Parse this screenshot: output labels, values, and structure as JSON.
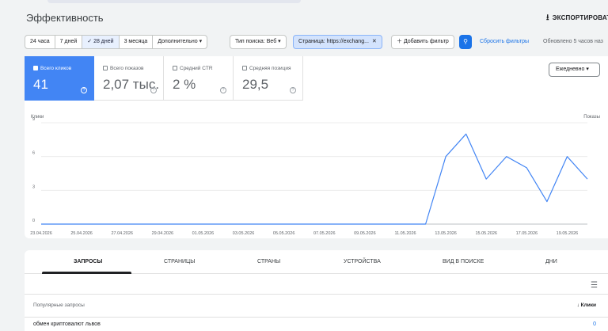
{
  "header": {
    "title": "Эффективность",
    "export_label": "ЭКСПОРТИРОВАТЬ"
  },
  "filters": {
    "date_ranges": [
      "24 часа",
      "7 дней",
      "28 дней",
      "3 месяца",
      "Дополнительно"
    ],
    "selected_range": "28 дней",
    "search_type": "Тип поиска: Веб",
    "page_filter": "Страница: https://exchang...",
    "add_filter": "Добавить фильтр",
    "reset": "Сбросить фильтры",
    "updated": "Обновлено 5 часов наз"
  },
  "metrics": [
    {
      "label": "Всего кликов",
      "value": "41",
      "active": true
    },
    {
      "label": "Всего показов",
      "value": "2,07 тыс.",
      "active": false
    },
    {
      "label": "Средний CTR",
      "value": "2 %",
      "active": false
    },
    {
      "label": "Средняя позиция",
      "value": "29,5",
      "active": false
    }
  ],
  "granularity": "Ежедневно",
  "chart_data": {
    "type": "line",
    "y_left_label": "Клики",
    "y_right_label": "Показы",
    "y_ticks": [
      "9",
      "6",
      "3",
      "0"
    ],
    "ylim": [
      0,
      9
    ],
    "x_tick_labels": [
      "23.04.2026",
      "25.04.2026",
      "27.04.2026",
      "29.04.2026",
      "01.05.2026",
      "03.05.2026",
      "05.05.2026",
      "07.05.2026",
      "09.05.2026",
      "11.05.2026",
      "13.05.2026",
      "15.05.2026",
      "17.05.2026",
      "19.05.2026"
    ],
    "x": [
      "23.04.2026",
      "24.04.2026",
      "25.04.2026",
      "26.04.2026",
      "27.04.2026",
      "28.04.2026",
      "29.04.2026",
      "30.04.2026",
      "01.05.2026",
      "02.05.2026",
      "03.05.2026",
      "04.05.2026",
      "05.05.2026",
      "06.05.2026",
      "07.05.2026",
      "08.05.2026",
      "09.05.2026",
      "10.05.2026",
      "11.05.2026",
      "12.05.2026",
      "13.05.2026",
      "14.05.2026",
      "15.05.2026",
      "16.05.2026",
      "17.05.2026",
      "18.05.2026",
      "19.05.2026",
      "20.05.2026"
    ],
    "series": [
      {
        "values": [
          0,
          0,
          0,
          0,
          0,
          0,
          0,
          0,
          0,
          0,
          0,
          0,
          0,
          0,
          0,
          0,
          0,
          0,
          0,
          0,
          6,
          8,
          4,
          6,
          5,
          2,
          6,
          4
        ]
      }
    ],
    "color": "#4285f4",
    "grid": true
  },
  "tabs": [
    "ЗАПРОСЫ",
    "СТРАНИЦЫ",
    "СТРАНЫ",
    "УСТРОЙСТВА",
    "ВИД В ПОИСКЕ",
    "ДНИ"
  ],
  "table": {
    "col_query": "Популярные запросы",
    "col_clicks": "Клики",
    "rows": [
      {
        "query": "обмен криптовалют львов",
        "clicks": "0"
      }
    ]
  }
}
